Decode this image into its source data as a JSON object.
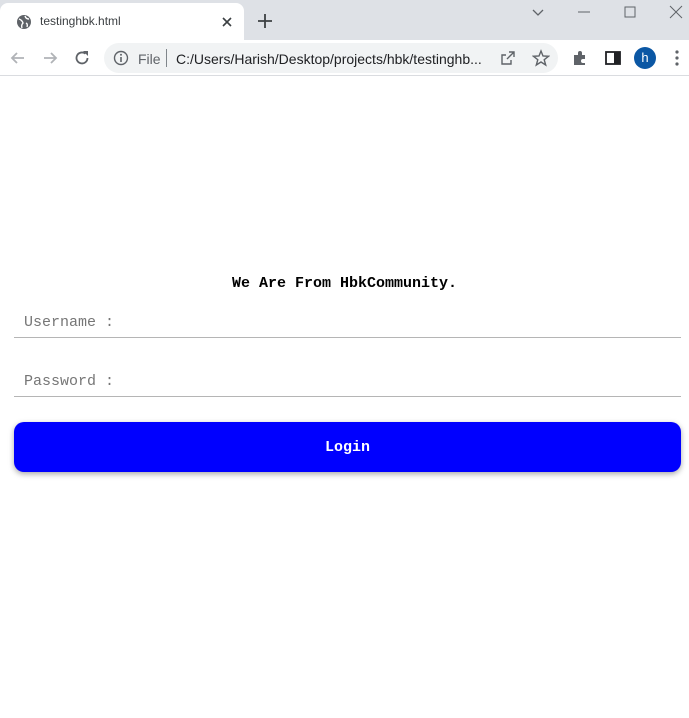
{
  "browser": {
    "tab": {
      "title": "testinghbk.html"
    },
    "address_bar": {
      "scheme_label": "File",
      "url": "C:/Users/Harish/Desktop/projects/hbk/testinghb..."
    },
    "profile_initial": "h"
  },
  "page": {
    "heading": "We Are From HbkCommunity.",
    "username": {
      "placeholder": "Username :",
      "value": ""
    },
    "password": {
      "placeholder": "Password :",
      "value": ""
    },
    "login_label": "Login"
  },
  "colors": {
    "login_button": "#0000ff",
    "tabstrip": "#dee1e6",
    "avatar": "#0b57a4"
  }
}
